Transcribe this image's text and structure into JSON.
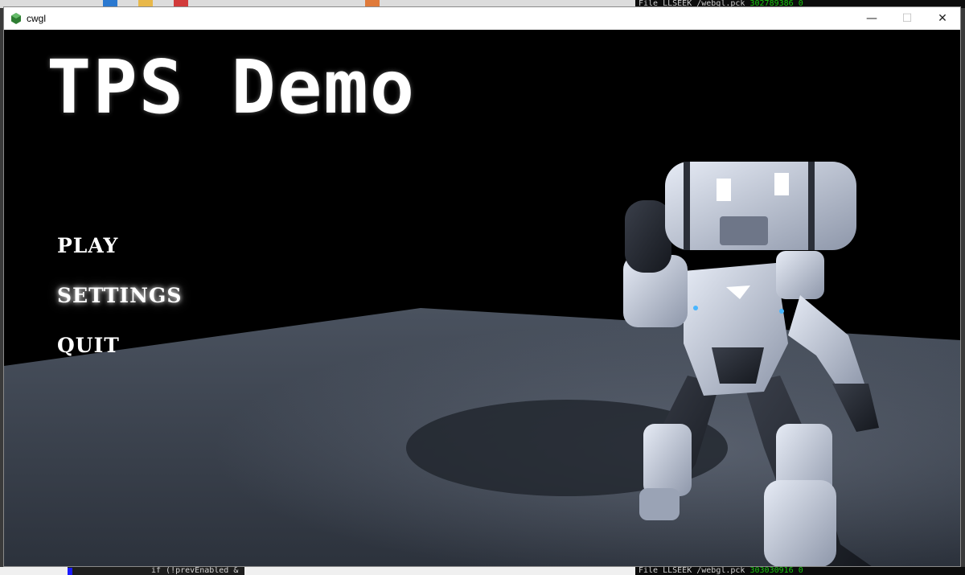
{
  "window": {
    "title": "cwgl",
    "minimize_symbol": "—",
    "maximize_symbol": "☐",
    "close_symbol": "✕"
  },
  "game": {
    "title": "TPS Demo",
    "menu": [
      {
        "label": "PLAY"
      },
      {
        "label": "SETTINGS"
      },
      {
        "label": "QUIT"
      }
    ]
  },
  "background_console": {
    "top_text": "File LLSEEK /webgl.pck",
    "top_number": "302789386 0",
    "bottom_text": "File LLSEEK /webgl.pck",
    "bottom_number": "303030916 0"
  },
  "background_editor": {
    "code_line": "if (!prevEnabled &"
  },
  "icons": [
    "app-icon",
    "minimize-icon",
    "maximize-icon",
    "close-icon"
  ],
  "colors": {
    "viewport_bg": "#000000",
    "floor": "#3b4350",
    "robot_body": "#c9d0de",
    "text": "#ffffff"
  }
}
